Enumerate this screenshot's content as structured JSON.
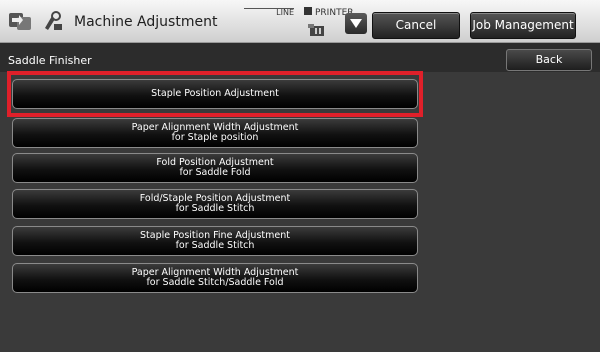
{
  "header": {
    "title": "Machine Adjustment",
    "line_label": "LINE",
    "printer_label": "PRINTER",
    "cancel_label": "Cancel",
    "job_management_label": "Job Management"
  },
  "subheader": {
    "section": "Saddle Finisher",
    "back_label": "Back"
  },
  "menu": {
    "items": [
      {
        "line1": "Staple Position Adjustment",
        "line2": "",
        "selected": true
      },
      {
        "line1": "Paper Alignment Width Adjustment",
        "line2": "for Staple position"
      },
      {
        "line1": "Fold Position Adjustment",
        "line2": "for Saddle Fold"
      },
      {
        "line1": "Fold/Staple Position Adjustment",
        "line2": "for Saddle Stitch"
      },
      {
        "line1": "Staple Position Fine Adjustment",
        "line2": "for Saddle Stitch"
      },
      {
        "line1": "Paper Alignment Width Adjustment",
        "line2": "for Saddle Stitch/Saddle Fold"
      }
    ]
  },
  "colors": {
    "highlight": "#e0202a",
    "background": "#3a3a3a"
  }
}
